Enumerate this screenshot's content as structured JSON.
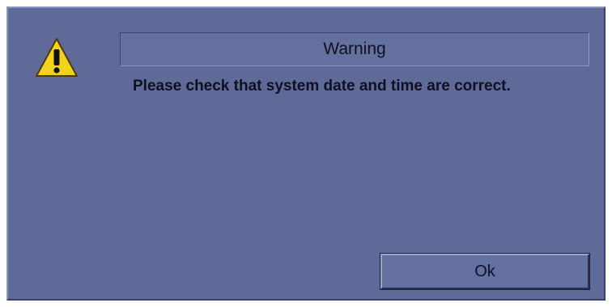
{
  "dialog": {
    "title": "Warning",
    "message": "Please check that system date and time are correct.",
    "icon": "warning-icon",
    "ok_label": "Ok"
  },
  "colors": {
    "background": "#5f6a98",
    "icon_fill": "#f2d21c"
  }
}
